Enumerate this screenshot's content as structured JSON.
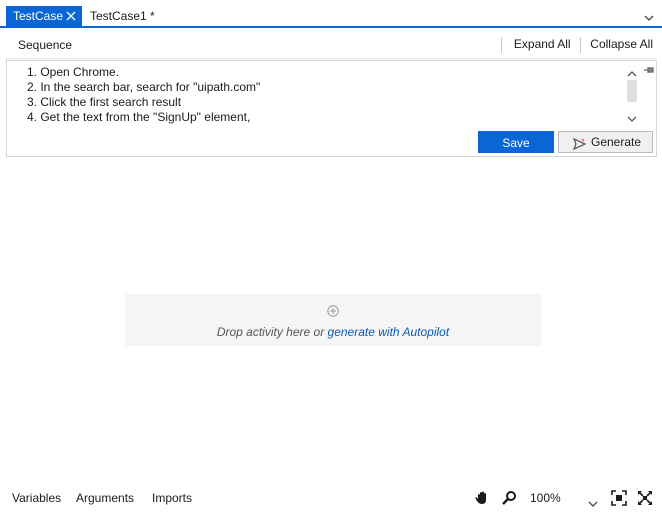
{
  "tabs": [
    {
      "label": "TestCase",
      "active": true
    },
    {
      "label": "TestCase1 *",
      "active": false
    }
  ],
  "sequence": {
    "title": "Sequence",
    "expand_all": "Expand All",
    "collapse_all": "Collapse All"
  },
  "prompt": {
    "lines": [
      "1. Open Chrome.",
      "2. In the search bar, search for \"uipath.com\"",
      "3. Click the first search result",
      "4. Get the text from the \"SignUp\" element,"
    ],
    "save_label": "Save",
    "generate_label": "Generate"
  },
  "canvas": {
    "drop_text": "Drop activity here or ",
    "drop_link": "generate with Autopilot"
  },
  "statusbar": {
    "variables": "Variables",
    "arguments": "Arguments",
    "imports": "Imports",
    "zoom": "100%"
  },
  "colors": {
    "accent": "#0a66d6",
    "link": "#0a5bb5"
  }
}
